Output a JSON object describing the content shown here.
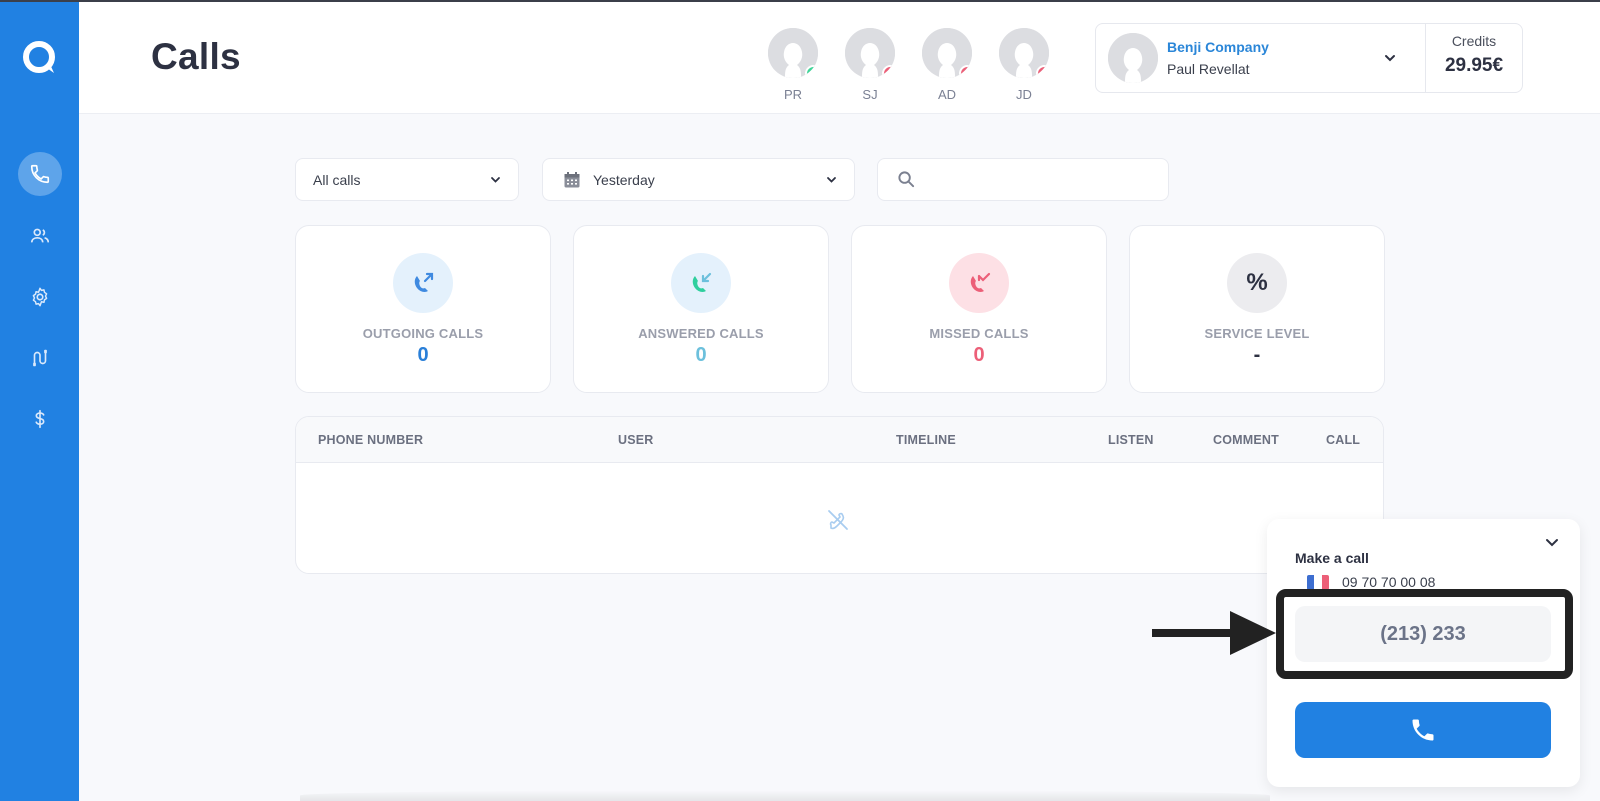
{
  "header": {
    "title": "Calls"
  },
  "sidebar": {
    "logo": "q-logo-icon",
    "items": [
      {
        "name": "calls",
        "icon": "phone-icon",
        "active": true
      },
      {
        "name": "users",
        "icon": "users-icon",
        "active": false
      },
      {
        "name": "settings",
        "icon": "gear-icon",
        "active": false
      },
      {
        "name": "integrations",
        "icon": "plug-icon",
        "active": false
      },
      {
        "name": "billing",
        "icon": "dollar-icon",
        "active": false
      }
    ]
  },
  "agents": [
    {
      "initials": "PR",
      "status": "available",
      "status_color": "#3ed598"
    },
    {
      "initials": "SJ",
      "status": "unavailable",
      "status_color": "#ec5f78"
    },
    {
      "initials": "AD",
      "status": "unavailable",
      "status_color": "#ec5f78"
    },
    {
      "initials": "JD",
      "status": "unavailable",
      "status_color": "#ec5f78"
    }
  ],
  "account": {
    "company": "Benji Company",
    "user": "Paul Revellat",
    "credits_label": "Credits",
    "credits_value": "29.95€"
  },
  "filters": {
    "call_type": "All calls",
    "date_range": "Yesterday",
    "search_placeholder": ""
  },
  "stats": [
    {
      "label": "OUTGOING CALLS",
      "value": "0",
      "color": "#2a7fd8",
      "icon": "outgoing-call-icon"
    },
    {
      "label": "ANSWERED CALLS",
      "value": "0",
      "color": "#6cc0dc",
      "icon": "incoming-call-icon"
    },
    {
      "label": "MISSED CALLS",
      "value": "0",
      "color": "#ec5f78",
      "icon": "missed-call-icon"
    },
    {
      "label": "SERVICE LEVEL",
      "value": "-",
      "color": "#2d3142",
      "icon": "percent-icon"
    }
  ],
  "table": {
    "columns": [
      "PHONE NUMBER",
      "USER",
      "TIMELINE",
      "LISTEN",
      "COMMENT",
      "CALL"
    ],
    "rows": [],
    "empty_icon": "no-calls-icon"
  },
  "dialer": {
    "title": "Make a call",
    "from_number": "09 70 70 00 08",
    "from_country": "FR",
    "number_value": "(213) 233",
    "call_button_icon": "phone-icon"
  },
  "colors": {
    "brand": "#2181e2",
    "background": "#f8f9fc"
  }
}
